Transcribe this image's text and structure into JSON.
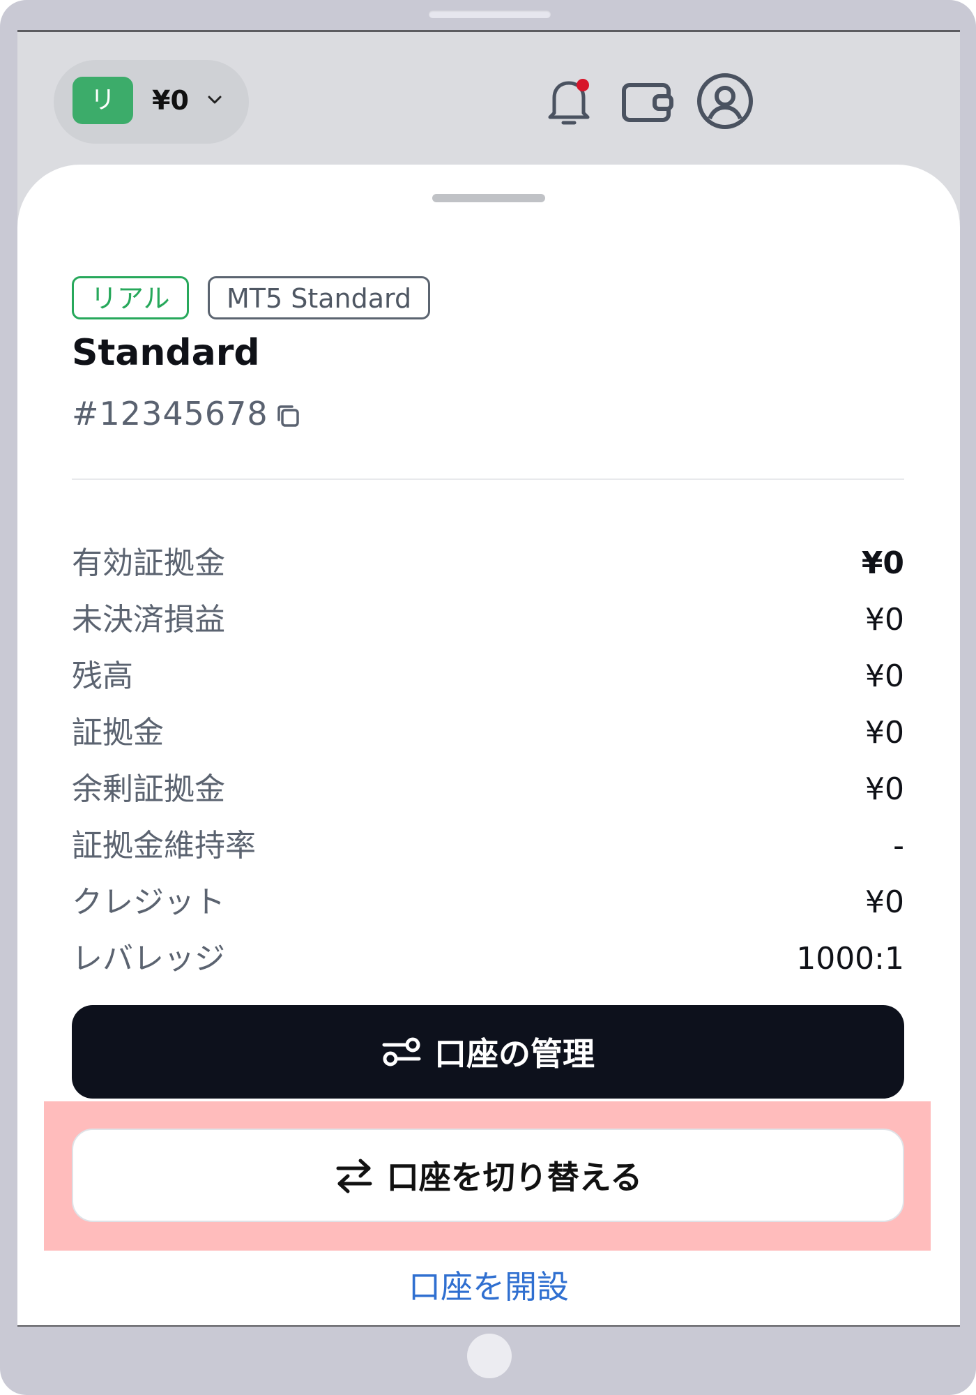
{
  "header": {
    "account_badge": "リ",
    "balance": "¥0"
  },
  "sheet": {
    "tags": {
      "real": "リアル",
      "platform": "MT5 Standard"
    },
    "account_name": "Standard",
    "account_number": "#12345678",
    "stats": [
      {
        "label": "有効証拠金",
        "value": "¥0"
      },
      {
        "label": "未決済損益",
        "value": "¥0"
      },
      {
        "label": "残高",
        "value": "¥0"
      },
      {
        "label": "証拠金",
        "value": "¥0"
      },
      {
        "label": "余剰証拠金",
        "value": "¥0"
      },
      {
        "label": "証拠金維持率",
        "value": "-"
      },
      {
        "label": "クレジット",
        "value": "¥0"
      },
      {
        "label": "レバレッジ",
        "value": "1000:1"
      }
    ],
    "manage_button": "口座の管理",
    "switch_button": "口座を切り替える",
    "open_account_link": "口座を開設"
  },
  "colors": {
    "accent_green": "#27a85b",
    "primary_dark": "#0d111c",
    "link_blue": "#2f6fd0",
    "highlight": "#ffbcbc",
    "notification_dot": "#d7152a"
  },
  "icons": [
    "bell-icon",
    "wallet-icon",
    "profile-icon",
    "chevron-down-icon",
    "copy-icon",
    "settings-sliders-icon",
    "switch-arrows-icon"
  ]
}
